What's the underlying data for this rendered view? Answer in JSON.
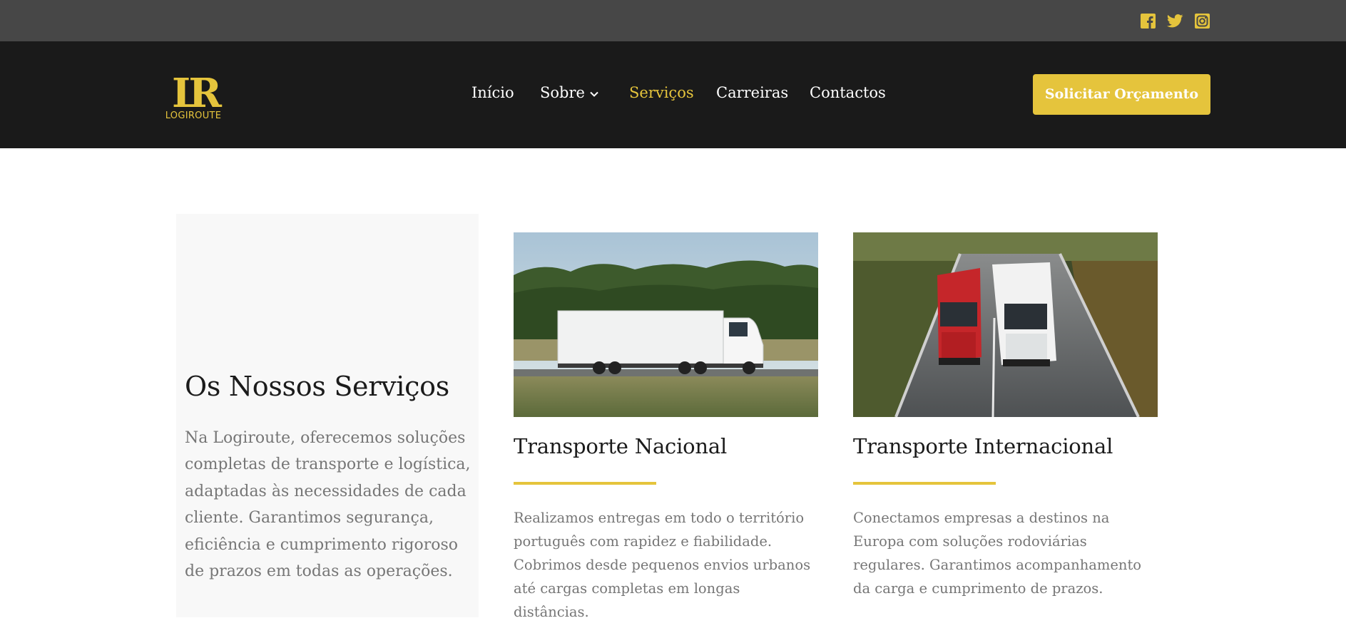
{
  "social": [
    {
      "name": "facebook-icon"
    },
    {
      "name": "twitter-icon"
    },
    {
      "name": "instagram-icon"
    }
  ],
  "brand": {
    "monogram": "LR",
    "name": "LOGIROUTE",
    "accent": "#e5c43c"
  },
  "nav": {
    "items": [
      {
        "label": "Início"
      },
      {
        "label": "Sobre"
      },
      {
        "label": "Serviços",
        "active": true
      },
      {
        "label": "Carreiras"
      },
      {
        "label": "Contactos"
      }
    ],
    "cta": "Solicitar Orçamento"
  },
  "intro": {
    "title": "Os Nossos Serviços",
    "text": "Na Logiroute, oferecemos soluções completas de transporte e logística, adaptadas às necessidades de cada cliente. Garantimos segurança, eficiência e cumprimento rigoroso de prazos em todas as operações."
  },
  "services": [
    {
      "title": "Transporte Nacional",
      "text": "Realizamos entregas em todo o território português com rapidez e fiabilidade. Cobrimos desde pequenos envios urbanos até cargas completas em longas distâncias."
    },
    {
      "title": "Transporte Internacional",
      "text": "Conectamos empresas a destinos na Europa com soluções rodoviárias regulares. Garantimos acompanhamento da carga e cumprimento de prazos."
    }
  ]
}
